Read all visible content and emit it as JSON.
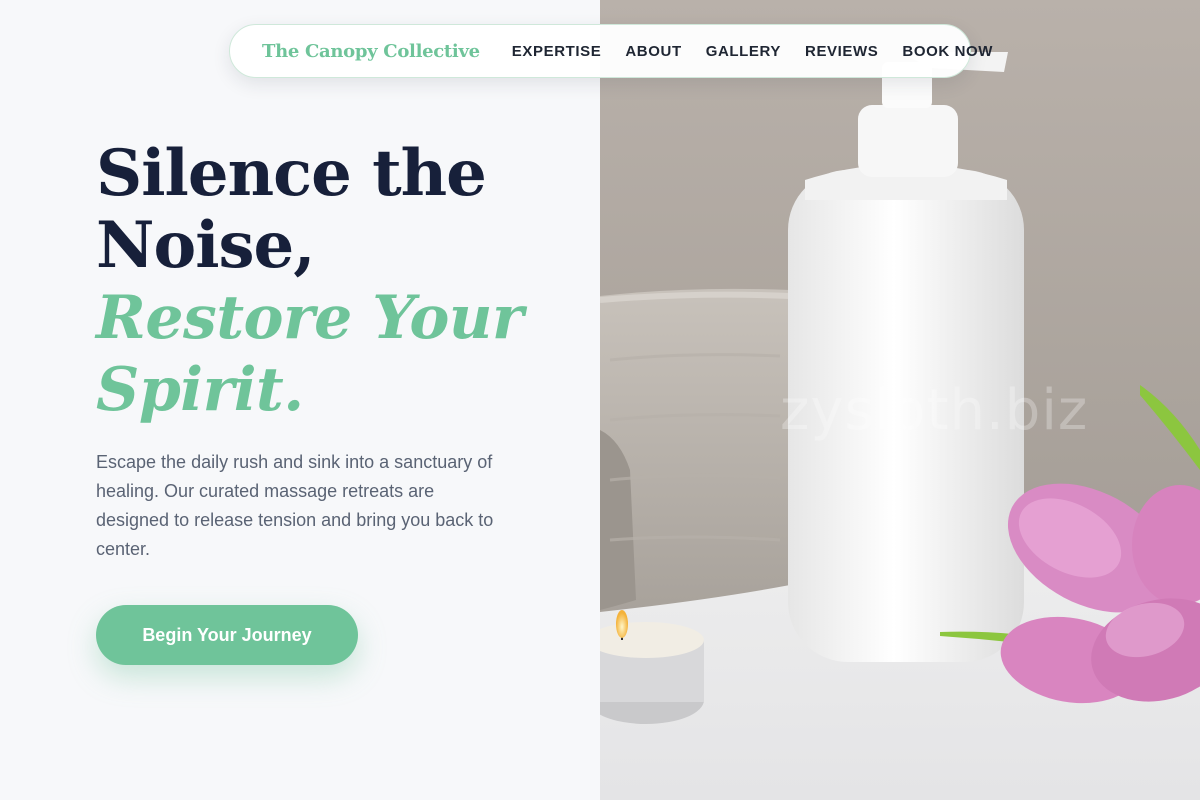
{
  "nav": {
    "brand": "The Canopy Collective",
    "links": [
      "EXPERTISE",
      "ABOUT",
      "GALLERY",
      "REVIEWS",
      "BOOK NOW"
    ]
  },
  "hero": {
    "headline_line1": "Silence the",
    "headline_line2": "Noise,",
    "accent_line1": "Restore Your",
    "accent_line2": "Spirit.",
    "intro": "Escape the daily rush and sink into a sanctuary of healing. Our curated massage retreats are designed to release tension and bring you back to center.",
    "cta_label": "Begin Your Journey"
  },
  "watermark": "zysloth.biz",
  "colors": {
    "accent": "#6fc49a",
    "headline": "#17203a",
    "body_text": "#5a6374",
    "background": "#f7f8fa"
  }
}
